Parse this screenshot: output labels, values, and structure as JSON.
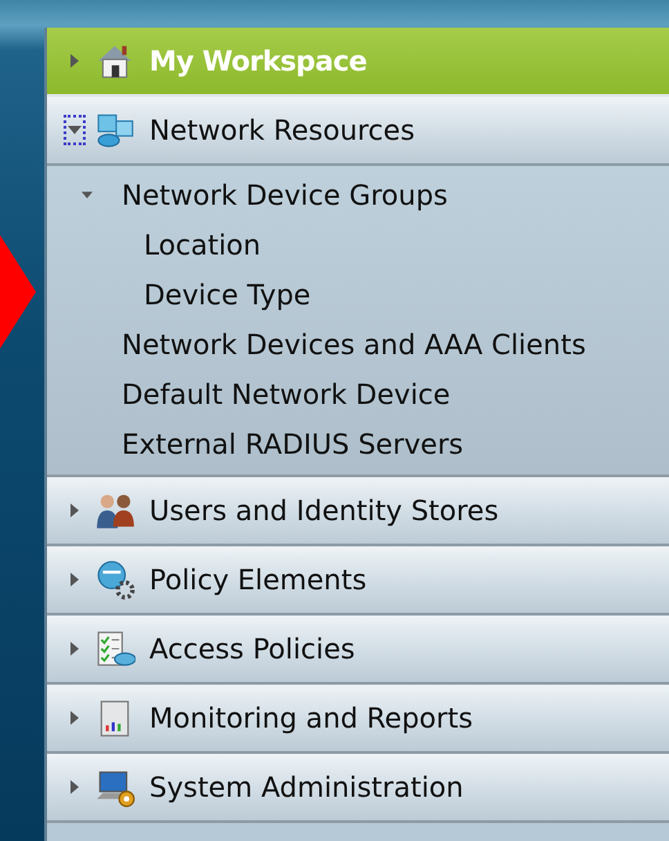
{
  "sections": [
    {
      "kind": "workspace",
      "label": "My Workspace",
      "expanded": false,
      "focused": false
    },
    {
      "kind": "drawer",
      "label": "Network Resources",
      "expanded": true,
      "focused": true,
      "tree": [
        {
          "label": "Network Device Groups",
          "expanded": true,
          "children": [
            {
              "label": "Location"
            },
            {
              "label": "Device Type"
            }
          ]
        },
        {
          "label": "Network Devices and AAA Clients"
        },
        {
          "label": "Default Network Device"
        },
        {
          "label": "External RADIUS Servers"
        }
      ]
    },
    {
      "kind": "drawer",
      "label": "Users and Identity Stores",
      "expanded": false,
      "focused": false
    },
    {
      "kind": "drawer",
      "label": "Policy Elements",
      "expanded": false,
      "focused": false
    },
    {
      "kind": "drawer",
      "label": "Access Policies",
      "expanded": false,
      "focused": false
    },
    {
      "kind": "drawer",
      "label": "Monitoring and Reports",
      "expanded": false,
      "focused": false
    },
    {
      "kind": "drawer",
      "label": "System Administration",
      "expanded": false,
      "focused": false
    }
  ]
}
